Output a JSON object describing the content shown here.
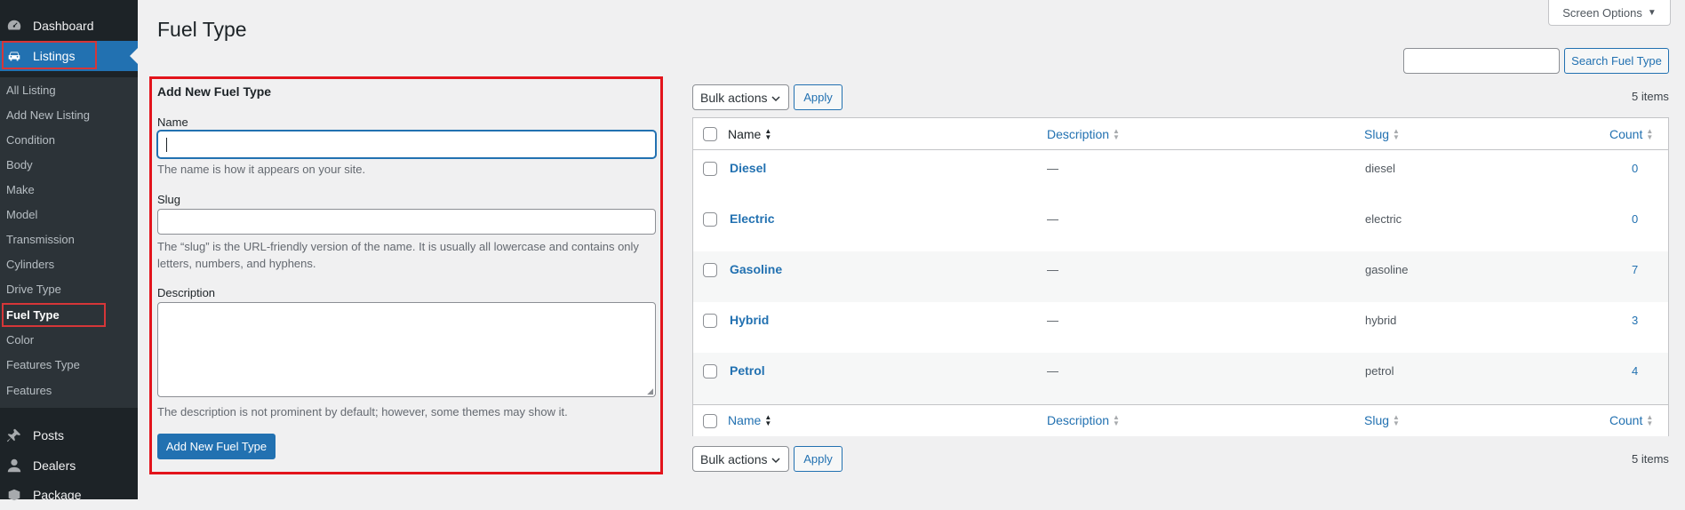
{
  "sidebar": {
    "top_items": [
      {
        "label": "Dashboard",
        "icon": "dashboard-icon"
      },
      {
        "label": "Listings",
        "icon": "car-icon"
      }
    ],
    "submenu": [
      "All Listing",
      "Add New Listing",
      "Condition",
      "Body",
      "Make",
      "Model",
      "Transmission",
      "Cylinders",
      "Drive Type",
      "Fuel Type",
      "Color",
      "Features Type",
      "Features"
    ],
    "bottom_items": [
      {
        "label": "Posts",
        "icon": "pin-icon"
      },
      {
        "label": "Dealers",
        "icon": "user-icon"
      },
      {
        "label": "Package",
        "icon": "package-icon"
      }
    ]
  },
  "page": {
    "title": "Fuel Type",
    "screen_options": "Screen Options",
    "search_value": "",
    "search_button": "Search Fuel Type"
  },
  "form": {
    "heading": "Add New Fuel Type",
    "name_label": "Name",
    "name_value": "",
    "name_help": "The name is how it appears on your site.",
    "slug_label": "Slug",
    "slug_value": "",
    "slug_help_1": "The “slug” is the URL-friendly version of the name. It is usually all lowercase and contains only",
    "slug_help_2": "letters, numbers, and hyphens.",
    "description_label": "Description",
    "description_value": "",
    "description_help": "The description is not prominent by default; however, some themes may show it.",
    "submit": "Add New Fuel Type"
  },
  "bulk": {
    "select_value": "Bulk actions",
    "apply": "Apply",
    "items_count": "5 items"
  },
  "table": {
    "columns": [
      "Name",
      "Description",
      "Slug",
      "Count"
    ],
    "rows": [
      {
        "name": "Diesel",
        "description": "—",
        "slug": "diesel",
        "count": "0"
      },
      {
        "name": "Electric",
        "description": "—",
        "slug": "electric",
        "count": "0"
      },
      {
        "name": "Gasoline",
        "description": "—",
        "slug": "gasoline",
        "count": "7"
      },
      {
        "name": "Hybrid",
        "description": "—",
        "slug": "hybrid",
        "count": "3"
      },
      {
        "name": "Petrol",
        "description": "—",
        "slug": "petrol",
        "count": "4"
      }
    ]
  },
  "colors": {
    "accent": "#2271b1",
    "sidebar_bg": "#1d2327",
    "highlight": "#d63638"
  }
}
